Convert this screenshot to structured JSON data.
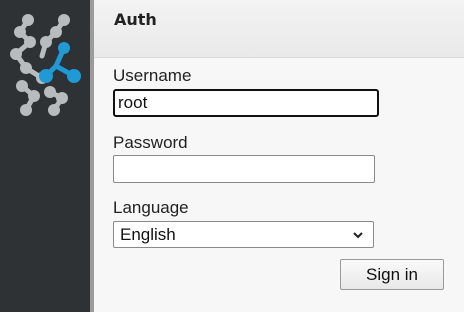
{
  "header": {
    "title": "Auth"
  },
  "form": {
    "username": {
      "label": "Username",
      "value": "root"
    },
    "password": {
      "label": "Password",
      "value": ""
    },
    "language": {
      "label": "Language",
      "selected": "English"
    },
    "submit_label": "Sign in"
  },
  "sidebar": {
    "logo_icon": "network-nodes-logo"
  },
  "colors": {
    "sidebar_bg": "#2f3234",
    "logo_grey": "#b9bcbe",
    "logo_accent": "#1e9ad6",
    "header_bg": "#eeeeee"
  }
}
